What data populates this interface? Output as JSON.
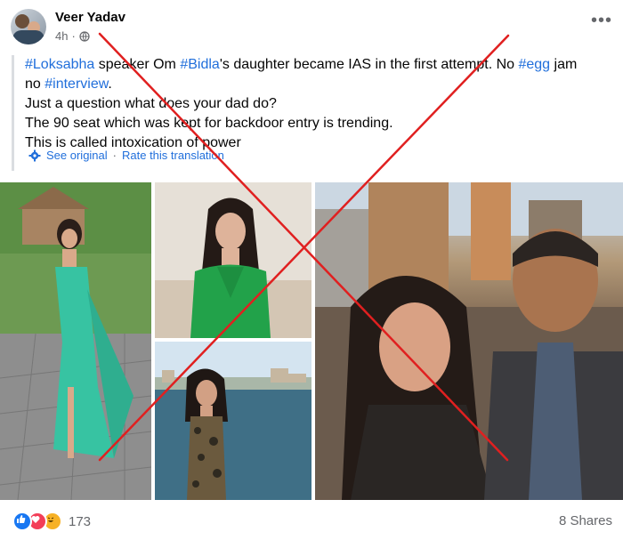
{
  "post": {
    "author": "Veer Yadav",
    "time": "4h",
    "more_icon": "more-horizontal-icon",
    "privacy_icon": "globe-icon",
    "lines": [
      {
        "segments": [
          {
            "text": "#Loksabha",
            "hashtag": true
          },
          {
            "text": " speaker Om ",
            "hashtag": false
          },
          {
            "text": "#Bidla",
            "hashtag": true
          },
          {
            "text": "'s daughter became IAS in the first attempt. No ",
            "hashtag": false
          },
          {
            "text": "#egg",
            "hashtag": true
          },
          {
            "text": " jam",
            "hashtag": false
          }
        ]
      },
      {
        "segments": [
          {
            "text": "no ",
            "hashtag": false
          },
          {
            "text": "#interview",
            "hashtag": true
          },
          {
            "text": ".",
            "hashtag": false
          }
        ]
      },
      {
        "segments": [
          {
            "text": "Just a question what does your dad do?",
            "hashtag": false
          }
        ]
      },
      {
        "segments": [
          {
            "text": "The 90 seat which was kept for backdoor entry is trending.",
            "hashtag": false
          }
        ]
      },
      {
        "segments": [
          {
            "text": "This is called intoxication of power",
            "hashtag": false
          }
        ]
      }
    ],
    "see_original": "See original",
    "separator": "·",
    "rate_translation": "Rate this translation"
  },
  "footer": {
    "reaction_count": "173",
    "shares": "8 Shares",
    "reaction_icons": [
      "like-icon",
      "love-icon",
      "haha-icon"
    ]
  },
  "colors": {
    "hashtag": "#216fdb",
    "cross": "#e02020",
    "meta": "#65676b"
  }
}
